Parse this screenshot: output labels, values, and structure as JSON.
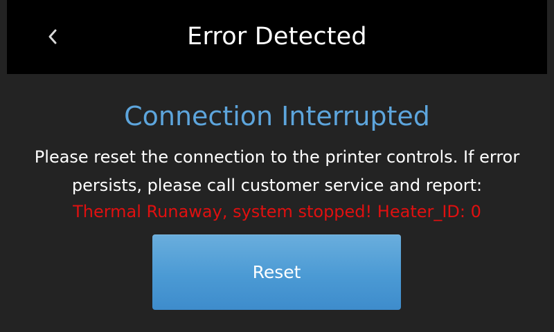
{
  "header": {
    "title": "Error Detected",
    "back_icon": "chevron-left-icon"
  },
  "error": {
    "title": "Connection Interrupted",
    "message": "Please reset the connection to the printer controls. If error persists, please call customer service and report:",
    "detail": "Thermal Runaway, system stopped! Heater_ID: 0"
  },
  "actions": {
    "reset_label": "Reset"
  },
  "colors": {
    "background": "#232323",
    "header_background": "#000000",
    "title_accent": "#5da5dc",
    "error_red": "#e01010",
    "button_blue": "#4b9ad4"
  }
}
